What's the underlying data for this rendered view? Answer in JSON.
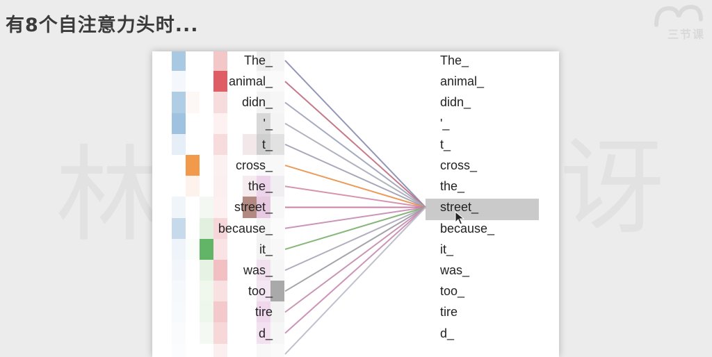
{
  "title": "有8个自注意力头时...",
  "logo_text": "三节课",
  "watermark": {
    "left": "林",
    "right": "讶",
    "bottom": "三节课"
  },
  "tokens": [
    "The_",
    "animal_",
    "didn_",
    "'_",
    "t_",
    "cross_",
    "the_",
    "street_",
    "because_",
    "it_",
    "was_",
    "too_",
    "tire",
    "d_",
    "_"
  ],
  "selected_token": "street_",
  "heat_columns": [
    [
      "#a9c8e2",
      "#f4f8fc",
      "#b0cde6",
      "#9fc2e0",
      "#e6eef7",
      "#ffffff",
      "#ffffff",
      "#f0f5fa",
      "#c6daec",
      "#eef4fa",
      "#f2f6fb",
      "#f5f9fc",
      "#f7fafd",
      "#f9fbfd",
      "#fafcfe"
    ],
    [
      "#ffffff",
      "#ffffff",
      "#fdf8f5",
      "#ffffff",
      "#ffffff",
      "#f19a4c",
      "#fdf3ec",
      "#ffffff",
      "#ffffff",
      "#fbfdfb",
      "#ffffff",
      "#ffffff",
      "#ffffff",
      "#ffffff",
      "#ffffff"
    ],
    [
      "#ffffff",
      "#ffffff",
      "#ffffff",
      "#ffffff",
      "#ffffff",
      "#ffffff",
      "#ffffff",
      "#f3f9f2",
      "#e2f1df",
      "#62b466",
      "#e6f3e4",
      "#f0f8ee",
      "#eef7ec",
      "#f4faf3",
      "#ffffff"
    ],
    [
      "#f3c7c8",
      "#df5d64",
      "#f7dcdd",
      "#fdf1f1",
      "#f8dbdc",
      "#fcf1f1",
      "#fcefef",
      "#fcf0f0",
      "#f6d6d8",
      "#f9e3e4",
      "#f2c0c2",
      "#f9e0e1",
      "#f4c9cb",
      "#f7d7d8",
      "#fcefef"
    ],
    [
      "#ffffff",
      "#ffffff",
      "#ffffff",
      "#ffffff",
      "#f2e8ea",
      "#ffffff",
      "#f6ebef",
      "#b28a82",
      "#ffffff",
      "#ffffff",
      "#ffffff",
      "#ffffff",
      "#ffffff",
      "#ffffff",
      "#ffffff"
    ],
    [
      "#f5f5f5",
      "#fafafa",
      "#f6f6f6",
      "#f4f4f4",
      "#e2e2e2",
      "#f8f8f8",
      "#f0eef0",
      "#f7f7f7",
      "#fbfbfb",
      "#f8f8f8",
      "#f6f6f6",
      "#a9a9a9",
      "#f2f2f2",
      "#f6f6f6",
      "#fafafa"
    ],
    [
      "#eeeeee",
      "#f9f9f9",
      "#f3f3f3",
      "#d8d8d8",
      "#cfcfcf",
      "#f9f9f9",
      "#eed4ea",
      "#e8c9e2",
      "#f4f4f4",
      "#f3f3f3",
      "#f1e1ef",
      "#f5e6f3",
      "#efd8ec",
      "#f3e0f0",
      "#f8f8f8"
    ]
  ],
  "line_colors": [
    "#8a8ab0",
    "#c06a7e",
    "#9aa0b8",
    "#a9aab6",
    "#9d9db3",
    "#e7914a",
    "#d28aa6",
    "#c5739a",
    "#c38bb0",
    "#79ae6a",
    "#a6a6b7",
    "#9a9aa2",
    "#c28bab",
    "#c68ab0",
    "#b9b9c6"
  ]
}
